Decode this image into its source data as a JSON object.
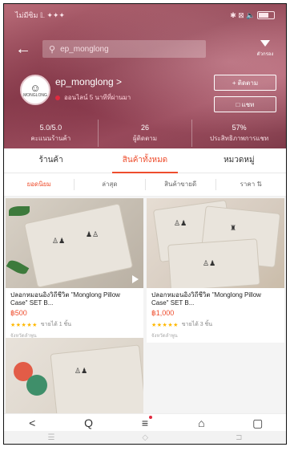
{
  "status_bar": {
    "left": "ไม่มีซิม 𝕃 ✦✦✦",
    "right": "✱ ⊠ 🔈"
  },
  "search": {
    "placeholder": "ep_monglong"
  },
  "filter": {
    "label": "ตัวกรอง"
  },
  "shop": {
    "logo_text": "MONGLONG",
    "name": "ep_monglong >",
    "subline": "ออนไลน์ 5 นาทีที่ผ่านมา",
    "follow_label": "+ ติดตาม",
    "chat_label": "แชท"
  },
  "stats": [
    {
      "value": "5.0/5.0",
      "label": "คะแนนร้านค้า"
    },
    {
      "value": "26",
      "label": "ผู้ติดตาม"
    },
    {
      "value": "57%",
      "label": "ประสิทธิภาพการแชท"
    }
  ],
  "main_tabs": [
    "ร้านค้า",
    "สินค้าทั้งหมด",
    "หมวดหมู่"
  ],
  "sort_tabs": [
    "ยอดนิยม",
    "ล่าสุด",
    "สินค้าขายดี",
    "ราคา ⇅"
  ],
  "products": [
    {
      "title": "ปลอกหมอนอิงวิถีชีวิต \"Monglong Pillow Case\" SET B...",
      "price": "฿500",
      "stars": "★★★★★",
      "sold": "ขายได้ 1 ชิ้น",
      "location": "จังหวัดลำพูน"
    },
    {
      "title": "ปลอกหมอนอิงวิถีชีวิต \"Monglong Pillow Case\" SET B...",
      "price": "฿1,000",
      "stars": "★★★★★",
      "sold": "ขายได้ 3 ชิ้น",
      "location": "จังหวัดลำพูน"
    }
  ],
  "navbar": [
    "<",
    "Q",
    "≡",
    "⌂",
    "▢"
  ],
  "sysbar": [
    "☰",
    "◇",
    "⊐"
  ]
}
